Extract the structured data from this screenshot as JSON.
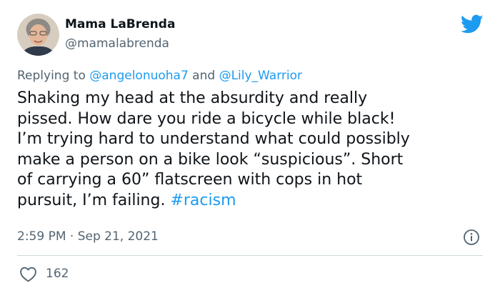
{
  "author": {
    "display_name": "Mama LaBrenda",
    "handle": "@mamalabrenda"
  },
  "reply": {
    "prefix": "Replying to ",
    "mention_1": "@angelonuoha7",
    "conjunction": " and ",
    "mention_2": "@Lily_Warrior"
  },
  "tweet": {
    "text": "Shaking my head at the absurdity and really\npissed. How dare you ride a bicycle while black!\nI’m trying hard to understand what could possibly\nmake a person on a bike look “suspicious”. Short\nof carrying a 60” flatscreen with cops in hot\npursuit, I’m failing. ",
    "hashtag": "#racism"
  },
  "meta": {
    "timestamp": "2:59 PM · Sep 21, 2021"
  },
  "engagement": {
    "likes": "162"
  },
  "icons": {
    "brand": "twitter-bird-icon",
    "info": "info-icon",
    "like": "heart-icon"
  },
  "colors": {
    "accent": "#1d9bf0",
    "secondary_text": "#536471",
    "divider": "#cfd9de"
  }
}
